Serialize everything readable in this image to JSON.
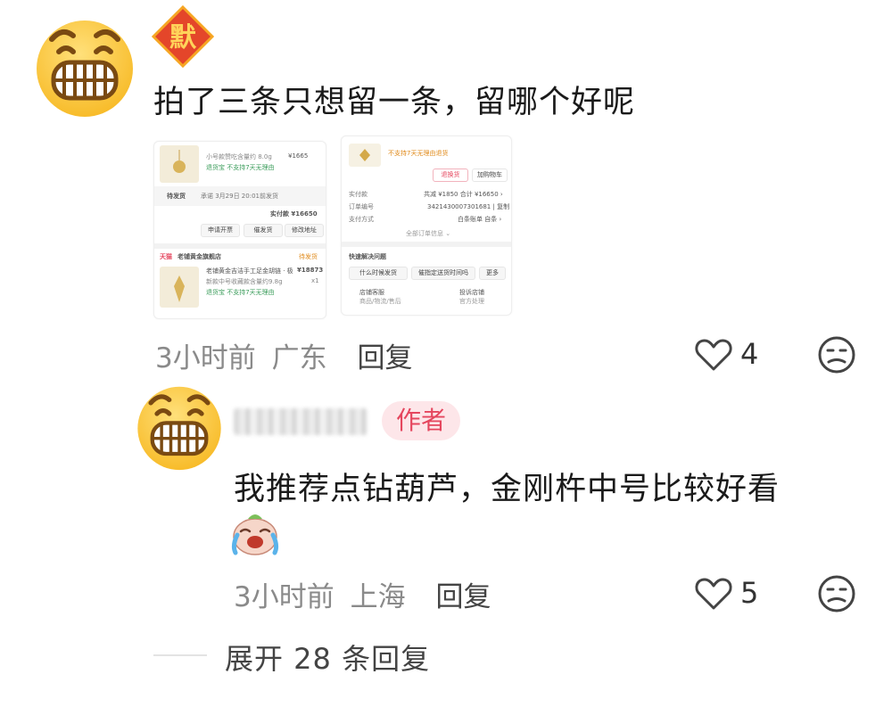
{
  "comment": {
    "text": "拍了三条只想留一条，留哪个好呢",
    "time": "3小时前",
    "location": "广东",
    "reply_label": "回复",
    "likes": "4",
    "badge_char": "默"
  },
  "screenshot_left": {
    "order_top": {
      "desc": "小号款赞吃含量约 8.0g",
      "tag": "退货宝  不支持7天无理由",
      "price": "¥1665"
    },
    "status": "待发货",
    "promise": "承诺 3月29日 20:01前发货",
    "paid": "实付款 ¥16650",
    "buttons": [
      "申请开票",
      "催发货",
      "修改地址"
    ],
    "shop_brand": "天猫",
    "shop_name": "老铺黄金旗舰店",
    "shop_status": "待发货",
    "item_title": "老铺黄金吉洁手工足金胡链 · 极",
    "item_price": "¥18873",
    "item_desc": "新款中号收藏款含量约9.8g",
    "item_qty": "x1",
    "item_tag": "退货宝  不支持7天无理由"
  },
  "screenshot_right": {
    "top_note": "不支持7天无理由退货",
    "btn_apply": "退换货",
    "btn_cart": "加购物车",
    "rows": [
      {
        "label": "实付款",
        "value": "共减 ¥1850  合计 ¥16650 ›"
      },
      {
        "label": "订单编号",
        "value": "3421430007301681 | 复制"
      },
      {
        "label": "支付方式",
        "value": "白条账单  自条 ›"
      }
    ],
    "all_info": "全部订单信息 ⌄",
    "quick_title": "快速解决问题",
    "quick_buttons": [
      "什么时候发货",
      "催指定送货时间吗",
      "更多"
    ],
    "service_left": "店铺客服",
    "service_left_sub": "商品/物流/售后",
    "service_right": "投诉店铺",
    "service_right_sub": "官方处理"
  },
  "reply": {
    "author_badge": "作者",
    "text": "我推荐点钻葫芦，金刚杵中号比较好看",
    "time": "3小时前",
    "location": "上海",
    "reply_label": "回复",
    "likes": "5"
  },
  "expand": {
    "label": "展开 28 条回复"
  }
}
